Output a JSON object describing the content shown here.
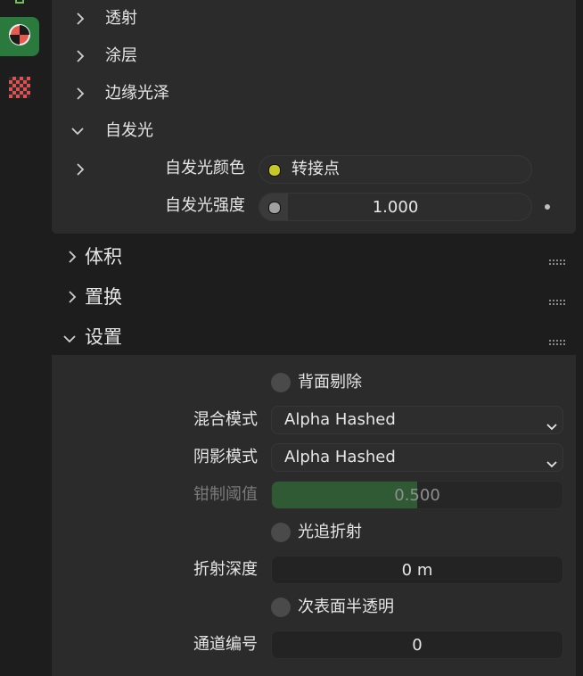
{
  "colors": {
    "active_tab": "#2a7a3d",
    "panel_bg": "#2b2b2b",
    "app_bg": "#1d1d1d",
    "factor_fill": "#2f5a34",
    "socket_yellow": "#c7c729",
    "socket_gray": "#a1a1a1"
  },
  "sidebar": {
    "tabs": [
      {
        "icon": "object-data-icon"
      },
      {
        "icon": "material-icon",
        "active": true
      },
      {
        "icon": "texture-icon"
      }
    ]
  },
  "surface_subpanels": {
    "transmission": "透射",
    "coat": "涂层",
    "sheen": "边缘光泽",
    "emission": "自发光"
  },
  "emission": {
    "color_label": "自发光颜色",
    "color_value": "转接点",
    "strength_label": "自发光强度",
    "strength_value": "1.000"
  },
  "sections": {
    "volume": "体积",
    "displacement": "置换",
    "settings": "设置"
  },
  "settings": {
    "backface_culling": "背面剔除",
    "blend_mode_label": "混合模式",
    "blend_mode_value": "Alpha Hashed",
    "shadow_mode_label": "阴影模式",
    "shadow_mode_value": "Alpha Hashed",
    "clip_threshold_label": "钳制阈值",
    "clip_threshold_value": "0.500",
    "clip_threshold_fraction": 0.5,
    "raytrace_refraction": "光追折射",
    "refraction_depth_label": "折射深度",
    "refraction_depth_value": "0 m",
    "subsurface_translucency": "次表面半透明",
    "pass_index_label": "通道编号",
    "pass_index_value": "0"
  }
}
